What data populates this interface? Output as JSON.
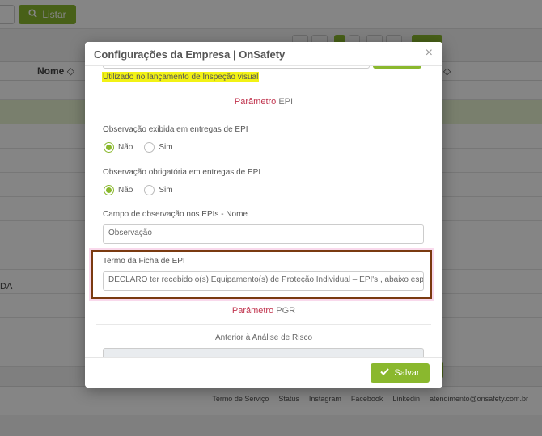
{
  "background": {
    "list_button": "Listar",
    "column_nome": "Nome",
    "row_text": "DA",
    "footer_links": [
      "Termo de Serviço",
      "Status",
      "Instagram",
      "Facebook",
      "Linkedin",
      "atendimento@onsafety.com.br"
    ]
  },
  "modal": {
    "title": "Configurações da Empresa | OnSafety",
    "close_symbol": "×",
    "hint": "Utilizado no lançamento de Inspeção visual",
    "section_epi": {
      "param": "Parâmetro",
      "name": "EPI"
    },
    "obs_exibida": {
      "label": "Observação exibida em entregas de EPI",
      "options": [
        "Não",
        "Sim"
      ],
      "selected": "Não"
    },
    "obs_obrigatoria": {
      "label": "Observação obrigatória em entregas de EPI",
      "options": [
        "Não",
        "Sim"
      ],
      "selected": "Não"
    },
    "campo_obs": {
      "label": "Campo de observação nos EPIs - Nome",
      "value": "Observação"
    },
    "termo_ficha": {
      "label": "Termo da Ficha de EPI",
      "value": "DECLARO ter recebido o(s) Equipamento(s) de Proteção Individual – EPI's., abaixo especific"
    },
    "section_pgr": {
      "param": "Parâmetro",
      "name": "PGR"
    },
    "anterior": {
      "label": "Anterior à Análise de Risco"
    },
    "save_label": "Salvar"
  },
  "colors": {
    "accent": "#8ab82e",
    "param_red": "#c0334d",
    "hint_bg": "#f2f215"
  }
}
